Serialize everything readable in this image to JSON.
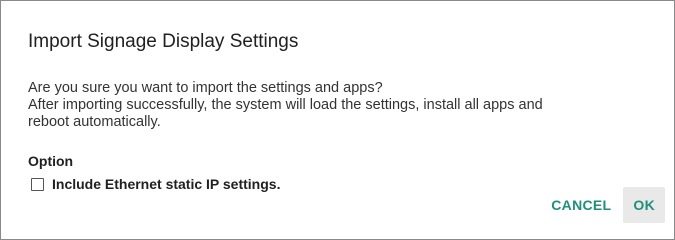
{
  "dialog": {
    "title": "Import Signage Display Settings",
    "message_lines": [
      "Are you sure you want to import the settings and apps?",
      "After importing successfully, the system will load the settings, install all apps and",
      "reboot automatically."
    ],
    "option_heading": "Option",
    "option": {
      "label": "Include Ethernet static IP settings.",
      "checked": false
    },
    "buttons": {
      "cancel_label": "CANCEL",
      "ok_label": "OK"
    }
  },
  "colors": {
    "accent": "#1f8f7c",
    "ok_button_bg": "#e9e9e9",
    "border": "#8a8a8a"
  }
}
